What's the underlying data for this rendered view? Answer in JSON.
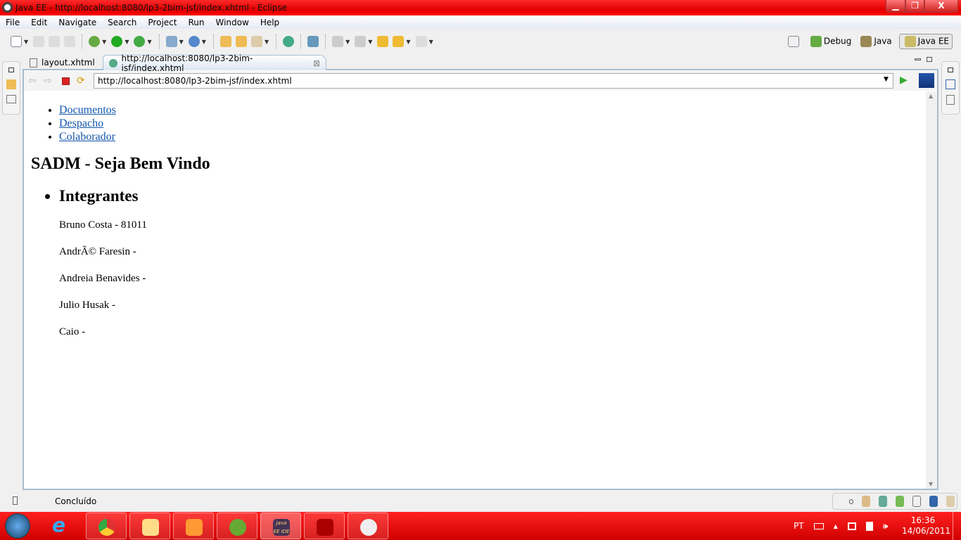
{
  "window": {
    "title": "Java EE - http://localhost:8080/lp3-2bim-jsf/index.xhtml - Eclipse",
    "minimize": "▁",
    "restore": "❐",
    "close": "X"
  },
  "menu": [
    "File",
    "Edit",
    "Navigate",
    "Search",
    "Project",
    "Run",
    "Window",
    "Help"
  ],
  "perspectives": [
    {
      "label": "Debug"
    },
    {
      "label": "Java"
    },
    {
      "label": "Java EE",
      "active": true
    }
  ],
  "tabs": [
    {
      "label": "layout.xhtml"
    },
    {
      "label": "http://localhost:8080/lp3-2bim-jsf/index.xhtml",
      "active": true,
      "close": "⊠"
    }
  ],
  "browser": {
    "url": "http://localhost:8080/lp3-2bim-jsf/index.xhtml"
  },
  "page": {
    "links": [
      "Documentos",
      "Despacho",
      "Colaborador"
    ],
    "heading": "SADM - Seja Bem Vindo",
    "section": "Integrantes",
    "members": [
      "Bruno Costa - 81011",
      "AndrÃ© Faresin -",
      "Andreia Benavides -",
      "Julio Husak -",
      "Caio -"
    ]
  },
  "status": {
    "text": "Concluído"
  },
  "taskbar": {
    "lang": "PT",
    "time": "16:36",
    "date": "14/06/2011",
    "apps": [
      "Internet Explorer",
      "Google Chrome",
      "Windows Explorer",
      "Media Player",
      "Messenger",
      "Java EE IDE",
      "Adobe Reader",
      "Paint"
    ],
    "java_label": "Java EE IDE"
  },
  "colors": {
    "titlebar": "#ff0000",
    "link": "#1155aa",
    "border": "#a8bccf"
  }
}
